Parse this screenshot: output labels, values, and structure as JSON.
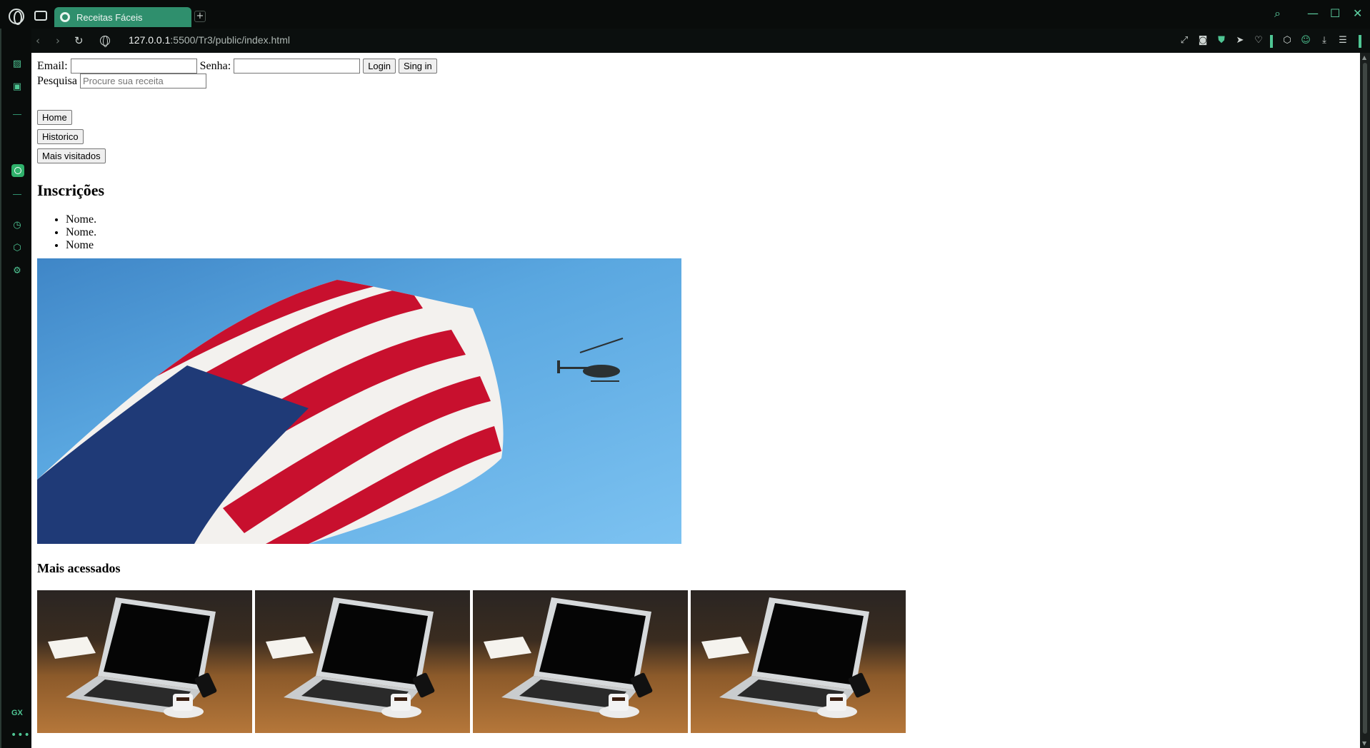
{
  "browser": {
    "tab_title": "Receitas Fáceis",
    "url_host": "127.0.0.1",
    "url_rest": ":5500/Tr3/public/index.html"
  },
  "login": {
    "email_label": "Email:",
    "email_value": "",
    "password_label": "Senha:",
    "password_value": "",
    "login_button": "Login",
    "signin_button": "Sing in"
  },
  "search": {
    "label": "Pesquisa",
    "placeholder": "Procure sua receita"
  },
  "nav": {
    "home": "Home",
    "history": "Historico",
    "most_visited": "Mais visitados"
  },
  "subscriptions": {
    "heading": "Inscrições",
    "items": [
      "Nome.",
      "Nome.",
      "Nome"
    ]
  },
  "most_accessed": {
    "heading": "Mais acessados",
    "count": 4
  },
  "colors": {
    "accent": "#2f8f6d",
    "sidebar_icon": "#4fc694"
  },
  "icons": {
    "hero_image": "american-flag-helicopter-photo",
    "thumbnail_image": "laptop-coffee-desk-photo"
  }
}
